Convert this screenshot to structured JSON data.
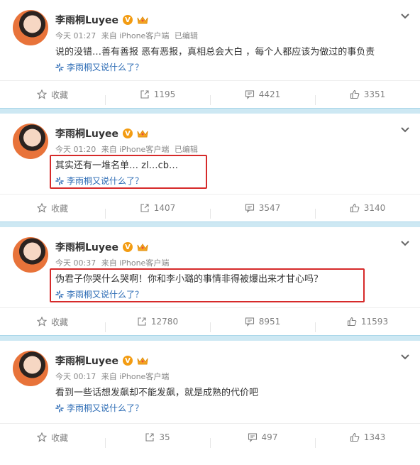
{
  "posts": [
    {
      "name": "李雨桐Luyee",
      "badge": "V",
      "time": "今天 01:27",
      "source": "来自 iPhone客户端",
      "edited": "已编辑",
      "text": "说的没错…善有善报 恶有恶报，真相总会大白 ，每个人都应该为做过的事负责",
      "link": "李雨桐又说什么了？",
      "fav_label": "收藏",
      "shares": "1195",
      "comments": "4421",
      "likes": "3351",
      "highlighted": false
    },
    {
      "name": "李雨桐Luyee",
      "badge": "V",
      "time": "今天 01:20",
      "source": "来自 iPhone客户端",
      "edited": "已编辑",
      "text": "其实还有一堆名单… zl…cb…",
      "link": "李雨桐又说什么了？",
      "fav_label": "收藏",
      "shares": "1407",
      "comments": "3547",
      "likes": "3140",
      "highlighted": true
    },
    {
      "name": "李雨桐Luyee",
      "badge": "V",
      "time": "今天 00:37",
      "source": "来自 iPhone客户端",
      "edited": "",
      "text": "伪君子你哭什么哭啊！你和李小璐的事情非得被爆出来才甘心吗？",
      "link": "李雨桐又说什么了？",
      "fav_label": "收藏",
      "shares": "12780",
      "comments": "8951",
      "likes": "11593",
      "highlighted": true
    },
    {
      "name": "李雨桐Luyee",
      "badge": "V",
      "time": "今天 00:17",
      "source": "来自 iPhone客户端",
      "edited": "",
      "text": "看到一些话想发飙却不能发飙，就是成熟的代价吧",
      "link": "李雨桐又说什么了？",
      "fav_label": "收藏",
      "shares": "35",
      "comments": "497",
      "likes": "1343",
      "highlighted": false
    }
  ],
  "colors": {
    "link": "#2d6cb5",
    "separator": "#cde8f3",
    "highlight_border": "#d62a2a",
    "verified_badge": "#f39c12"
  },
  "icons": [
    "chevron-down-icon",
    "crown-icon",
    "star-icon",
    "share-icon",
    "comment-icon",
    "like-icon",
    "spark-icon"
  ]
}
